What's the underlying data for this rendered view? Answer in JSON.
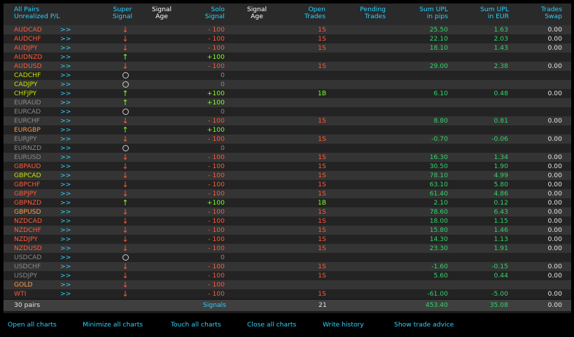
{
  "colors": {
    "header_cyan": "#2ad2ff",
    "header_white": "#ffffff",
    "red": "#ff5a3c",
    "green": "#7fff2a",
    "teal": "#34d36b",
    "gray": "#8a8a8a",
    "yellowgreen": "#c6e000",
    "orange": "#ff9a4a"
  },
  "header": {
    "all_pairs": "All Pairs\nUnrealized P/L",
    "super_signal": "Super\nSignal",
    "signal_age_1": "Signal\nAge",
    "solo_signal": "Solo\nSignal",
    "signal_age_2": "Signal\nAge",
    "open_trades": "Open\nTrades",
    "pending_trades": "Pending\nTrades",
    "sum_upl_pips": "Sum UPL\nin pips",
    "sum_upl_eur": "Sum UPL\nin EUR",
    "trades_swap": "Trades\nSwap"
  },
  "link_label": ">>",
  "rows": [
    {
      "pair": "AUDCAD",
      "pairColor": "red",
      "sig": "down",
      "solo": "- 100",
      "soloColor": "red",
      "open": "1S",
      "pips": "25.50",
      "eur": "1.63",
      "swap": "0.00"
    },
    {
      "pair": "AUDCHF",
      "pairColor": "red",
      "sig": "down",
      "solo": "- 100",
      "soloColor": "red",
      "open": "1S",
      "pips": "22.10",
      "eur": "2.03",
      "swap": "0.00"
    },
    {
      "pair": "AUDJPY",
      "pairColor": "red",
      "sig": "down",
      "solo": "- 100",
      "soloColor": "red",
      "open": "1S",
      "pips": "18.10",
      "eur": "1.43",
      "swap": "0.00"
    },
    {
      "pair": "AUDNZD",
      "pairColor": "red",
      "sig": "up",
      "solo": "+100",
      "soloColor": "green",
      "open": "",
      "pips": "",
      "eur": "",
      "swap": ""
    },
    {
      "pair": "AUDUSD",
      "pairColor": "red",
      "sig": "down",
      "solo": "- 100",
      "soloColor": "red",
      "open": "1S",
      "pips": "29.00",
      "eur": "2.38",
      "swap": "0.00"
    },
    {
      "pair": "CADCHF",
      "pairColor": "yellowgreen",
      "sig": "neutral",
      "solo": "0",
      "soloColor": "gray",
      "open": "",
      "pips": "",
      "eur": "",
      "swap": ""
    },
    {
      "pair": "CADJPY",
      "pairColor": "yellowgreen",
      "sig": "neutral",
      "solo": "0",
      "soloColor": "gray",
      "open": "",
      "pips": "",
      "eur": "",
      "swap": ""
    },
    {
      "pair": "CHFJPY",
      "pairColor": "yellowgreen",
      "sig": "up",
      "solo": "+100",
      "soloColor": "green",
      "open": "1B",
      "pips": "6.10",
      "eur": "0.48",
      "swap": "0.00"
    },
    {
      "pair": "EURAUD",
      "pairColor": "gray",
      "sig": "up",
      "solo": "+100",
      "soloColor": "green",
      "open": "",
      "pips": "",
      "eur": "",
      "swap": ""
    },
    {
      "pair": "EURCAD",
      "pairColor": "gray",
      "sig": "neutral",
      "solo": "0",
      "soloColor": "gray",
      "open": "",
      "pips": "",
      "eur": "",
      "swap": ""
    },
    {
      "pair": "EURCHF",
      "pairColor": "gray",
      "sig": "down",
      "solo": "- 100",
      "soloColor": "red",
      "open": "1S",
      "pips": "8.80",
      "eur": "0.81",
      "swap": "0.00"
    },
    {
      "pair": "EURGBP",
      "pairColor": "orange",
      "sig": "up",
      "solo": "+100",
      "soloColor": "green",
      "open": "",
      "pips": "",
      "eur": "",
      "swap": ""
    },
    {
      "pair": "EURJPY",
      "pairColor": "gray",
      "sig": "down",
      "solo": "- 100",
      "soloColor": "red",
      "open": "1S",
      "pips": "-0.70",
      "eur": "-0.06",
      "swap": "0.00"
    },
    {
      "pair": "EURNZD",
      "pairColor": "gray",
      "sig": "neutral",
      "solo": "0",
      "soloColor": "gray",
      "open": "",
      "pips": "",
      "eur": "",
      "swap": ""
    },
    {
      "pair": "EURUSD",
      "pairColor": "gray",
      "sig": "down",
      "solo": "- 100",
      "soloColor": "red",
      "open": "1S",
      "pips": "16.30",
      "eur": "1.34",
      "swap": "0.00"
    },
    {
      "pair": "GBPAUD",
      "pairColor": "red",
      "sig": "down",
      "solo": "- 100",
      "soloColor": "red",
      "open": "1S",
      "pips": "30.50",
      "eur": "1.90",
      "swap": "0.00"
    },
    {
      "pair": "GBPCAD",
      "pairColor": "yellowgreen",
      "sig": "down",
      "solo": "- 100",
      "soloColor": "red",
      "open": "1S",
      "pips": "78.10",
      "eur": "4.99",
      "swap": "0.00"
    },
    {
      "pair": "GBPCHF",
      "pairColor": "red",
      "sig": "down",
      "solo": "- 100",
      "soloColor": "red",
      "open": "1S",
      "pips": "63.10",
      "eur": "5.80",
      "swap": "0.00"
    },
    {
      "pair": "GBPJPY",
      "pairColor": "red",
      "sig": "down",
      "solo": "- 100",
      "soloColor": "red",
      "open": "1S",
      "pips": "61.40",
      "eur": "4.86",
      "swap": "0.00"
    },
    {
      "pair": "GBPNZD",
      "pairColor": "red",
      "sig": "up",
      "solo": "+100",
      "soloColor": "green",
      "open": "1B",
      "pips": "2.10",
      "eur": "0.12",
      "swap": "0.00"
    },
    {
      "pair": "GBPUSD",
      "pairColor": "orange",
      "sig": "down",
      "solo": "- 100",
      "soloColor": "red",
      "open": "1S",
      "pips": "78.60",
      "eur": "6.43",
      "swap": "0.00"
    },
    {
      "pair": "NZDCAD",
      "pairColor": "red",
      "sig": "down",
      "solo": "- 100",
      "soloColor": "red",
      "open": "1S",
      "pips": "18.00",
      "eur": "1.15",
      "swap": "0.00"
    },
    {
      "pair": "NZDCHF",
      "pairColor": "red",
      "sig": "down",
      "solo": "- 100",
      "soloColor": "red",
      "open": "1S",
      "pips": "15.80",
      "eur": "1.46",
      "swap": "0.00"
    },
    {
      "pair": "NZDJPY",
      "pairColor": "red",
      "sig": "down",
      "solo": "- 100",
      "soloColor": "red",
      "open": "1S",
      "pips": "14.30",
      "eur": "1.13",
      "swap": "0.00"
    },
    {
      "pair": "NZDUSD",
      "pairColor": "red",
      "sig": "down",
      "solo": "- 100",
      "soloColor": "red",
      "open": "1S",
      "pips": "23.30",
      "eur": "1.91",
      "swap": "0.00"
    },
    {
      "pair": "USDCAD",
      "pairColor": "gray",
      "sig": "neutral",
      "solo": "0",
      "soloColor": "gray",
      "open": "",
      "pips": "",
      "eur": "",
      "swap": ""
    },
    {
      "pair": "USDCHF",
      "pairColor": "gray",
      "sig": "down",
      "solo": "- 100",
      "soloColor": "red",
      "open": "1S",
      "pips": "-1.60",
      "eur": "-0.15",
      "swap": "0.00"
    },
    {
      "pair": "USDJPY",
      "pairColor": "gray",
      "sig": "down",
      "solo": "- 100",
      "soloColor": "red",
      "open": "1S",
      "pips": "5.60",
      "eur": "0.44",
      "swap": "0.00"
    },
    {
      "pair": "GOLD",
      "pairColor": "orange",
      "sig": "down",
      "solo": "- 100",
      "soloColor": "red",
      "open": "",
      "pips": "",
      "eur": "",
      "swap": ""
    },
    {
      "pair": "WTI",
      "pairColor": "red",
      "sig": "down",
      "solo": "- 100",
      "soloColor": "red",
      "open": "1S",
      "pips": "-61.00",
      "eur": "-5.00",
      "swap": "0.00"
    }
  ],
  "summary": {
    "pairs": "30 pairs",
    "signals": "Signals",
    "open": "21",
    "pips": "453.40",
    "eur": "35.08",
    "swap": "0.00"
  },
  "bottom_links": [
    "Open all charts",
    "Minimize all charts",
    "Touch all charts",
    "Close all charts",
    "Write history",
    "Show trade advice"
  ]
}
